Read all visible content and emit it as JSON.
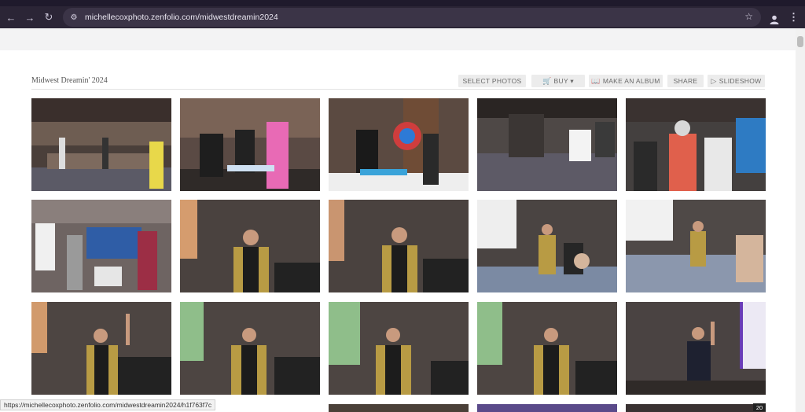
{
  "browser": {
    "url": "michellecoxphoto.zenfolio.com/midwestdreamin2024",
    "icons": {
      "back": "arrow-left-icon",
      "forward": "arrow-right-icon",
      "reload": "reload-icon",
      "site_info": "tune-icon",
      "bookmark": "star-icon",
      "profile": "person-icon",
      "menu": "kebab-menu-icon"
    }
  },
  "gallery": {
    "title": "Midwest Dreamin' 2024",
    "actions": {
      "select_photos": "SELECT PHOTOS",
      "buy": "BUY ▾",
      "make_album": "MAKE AN ALBUM",
      "share": "SHARE",
      "slideshow": "SLIDESHOW"
    },
    "photo_descriptions": [
      "conference hall with registration tables",
      "attendees at vendor table, pink hair",
      "prize wheel booth",
      "expo floor with signage",
      "attendees talking by blue backdrop",
      "booth visitors with monitor",
      "speaker with microphone, gold jacket",
      "speaker with microphone, gold jacket",
      "speaker on stage with audience",
      "audience raising hands",
      "speaker raising hand",
      "speaker with microphone",
      "speaker gesturing",
      "speaker gesturing",
      "speaker in cap raising arm"
    ]
  },
  "status_bar": {
    "link": "https://michellecoxphoto.zenfolio.com/midwestdreamin2024/h1f763f7c",
    "counter": "20"
  },
  "colors": {
    "chrome_bg": "#2b2536",
    "omnibox_bg": "#3b3447",
    "button_bg": "#ececec"
  }
}
